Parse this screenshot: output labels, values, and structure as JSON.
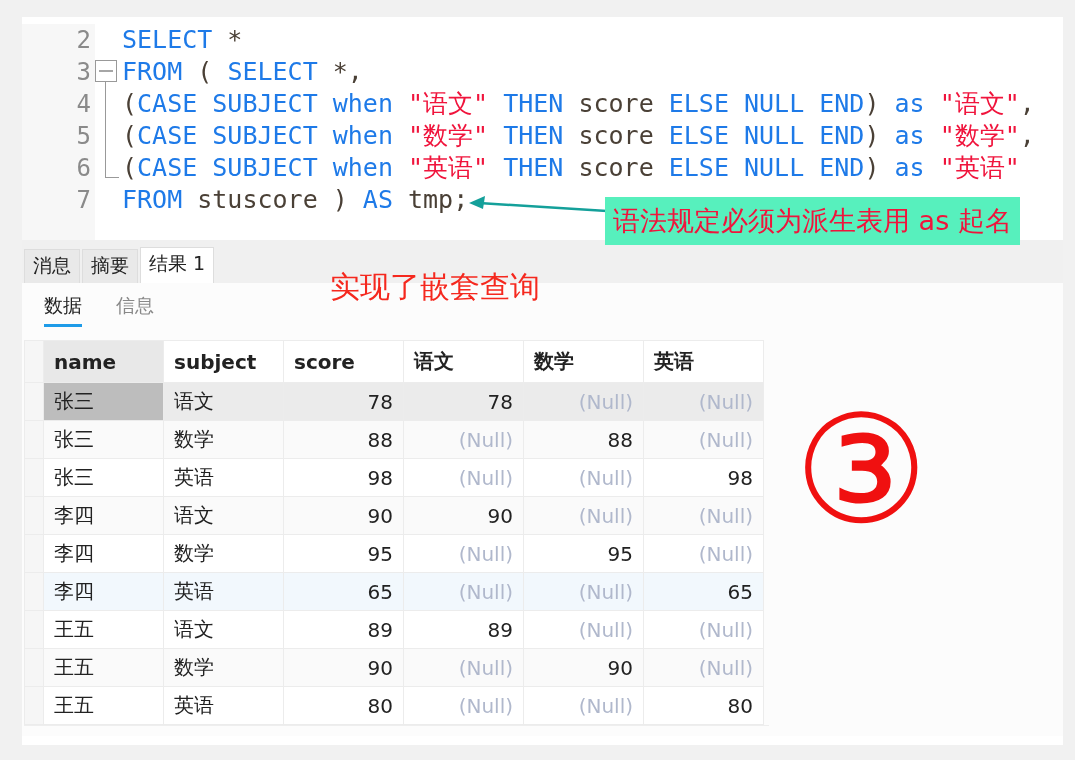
{
  "editor": {
    "lines": [
      {
        "number": "2",
        "kind": "plain",
        "tokens": [
          {
            "t": "SELECT",
            "kind": "keyword"
          },
          {
            "t": " *",
            "kind": "plain"
          }
        ]
      },
      {
        "number": "3",
        "kind": "foldstart",
        "tokens": [
          {
            "t": "FROM",
            "kind": "keyword"
          },
          {
            "t": " ( ",
            "kind": "plain"
          },
          {
            "t": "SELECT",
            "kind": "keyword"
          },
          {
            "t": " *,",
            "kind": "plain"
          }
        ]
      },
      {
        "number": "4",
        "kind": "foldinner",
        "tokens": [
          {
            "t": "(",
            "kind": "plain"
          },
          {
            "t": "CASE SUBJECT when ",
            "kind": "keyword"
          },
          {
            "t": "\"语文\"",
            "kind": "string"
          },
          {
            "t": " THEN ",
            "kind": "keyword"
          },
          {
            "t": "score",
            "kind": "plain"
          },
          {
            "t": " ELSE NULL END",
            "kind": "keyword"
          },
          {
            "t": ")",
            "kind": "plain"
          },
          {
            "t": " as ",
            "kind": "keyword"
          },
          {
            "t": "\"语文\"",
            "kind": "string"
          },
          {
            "t": ",",
            "kind": "plain"
          }
        ]
      },
      {
        "number": "5",
        "kind": "foldinner",
        "tokens": [
          {
            "t": "(",
            "kind": "plain"
          },
          {
            "t": "CASE SUBJECT when ",
            "kind": "keyword"
          },
          {
            "t": "\"数学\"",
            "kind": "string"
          },
          {
            "t": " THEN ",
            "kind": "keyword"
          },
          {
            "t": "score",
            "kind": "plain"
          },
          {
            "t": " ELSE NULL END",
            "kind": "keyword"
          },
          {
            "t": ")",
            "kind": "plain"
          },
          {
            "t": " as ",
            "kind": "keyword"
          },
          {
            "t": "\"数学\"",
            "kind": "string"
          },
          {
            "t": ",",
            "kind": "plain"
          }
        ]
      },
      {
        "number": "6",
        "kind": "foldend",
        "tokens": [
          {
            "t": "(",
            "kind": "plain"
          },
          {
            "t": "CASE SUBJECT when ",
            "kind": "keyword"
          },
          {
            "t": "\"英语\"",
            "kind": "string"
          },
          {
            "t": " THEN ",
            "kind": "keyword"
          },
          {
            "t": "score",
            "kind": "plain"
          },
          {
            "t": " ELSE NULL END",
            "kind": "keyword"
          },
          {
            "t": ")",
            "kind": "plain"
          },
          {
            "t": " as ",
            "kind": "keyword"
          },
          {
            "t": "\"英语\"",
            "kind": "string"
          }
        ]
      },
      {
        "number": "7",
        "kind": "plain",
        "tokens": [
          {
            "t": "FROM",
            "kind": "keyword"
          },
          {
            "t": " stuscore ) ",
            "kind": "plain"
          },
          {
            "t": "AS",
            "kind": "keyword"
          },
          {
            "t": " tmp;",
            "kind": "plain"
          }
        ]
      }
    ]
  },
  "callout": {
    "text": "语法规定必须为派生表用 as 起名"
  },
  "result_tabs": [
    {
      "label": "消息",
      "selected": false
    },
    {
      "label": "摘要",
      "selected": false
    },
    {
      "label": "结果 1",
      "selected": true
    }
  ],
  "annotation_note": "实现了嵌套查询",
  "sub_tabs": [
    {
      "label": "数据",
      "selected": true
    },
    {
      "label": "信息",
      "selected": false
    }
  ],
  "annotation_mark": "③",
  "table": {
    "columns": [
      {
        "label": "name",
        "numeric": false
      },
      {
        "label": "subject",
        "numeric": false
      },
      {
        "label": "score",
        "numeric": true
      },
      {
        "label": "语文",
        "numeric": true
      },
      {
        "label": "数学",
        "numeric": true
      },
      {
        "label": "英语",
        "numeric": true
      }
    ],
    "rows": [
      {
        "selected": true,
        "highlighted": false,
        "cells": [
          {
            "text": "张三",
            "null": false
          },
          {
            "text": "语文",
            "null": false
          },
          {
            "text": "78",
            "null": false
          },
          {
            "text": "78",
            "null": false
          },
          {
            "text": "(Null)",
            "null": true
          },
          {
            "text": "(Null)",
            "null": true
          }
        ]
      },
      {
        "selected": false,
        "highlighted": false,
        "cells": [
          {
            "text": "张三",
            "null": false
          },
          {
            "text": "数学",
            "null": false
          },
          {
            "text": "88",
            "null": false
          },
          {
            "text": "(Null)",
            "null": true
          },
          {
            "text": "88",
            "null": false
          },
          {
            "text": "(Null)",
            "null": true
          }
        ]
      },
      {
        "selected": false,
        "highlighted": false,
        "cells": [
          {
            "text": "张三",
            "null": false
          },
          {
            "text": "英语",
            "null": false
          },
          {
            "text": "98",
            "null": false
          },
          {
            "text": "(Null)",
            "null": true
          },
          {
            "text": "(Null)",
            "null": true
          },
          {
            "text": "98",
            "null": false
          }
        ]
      },
      {
        "selected": false,
        "highlighted": false,
        "cells": [
          {
            "text": "李四",
            "null": false
          },
          {
            "text": "语文",
            "null": false
          },
          {
            "text": "90",
            "null": false
          },
          {
            "text": "90",
            "null": false
          },
          {
            "text": "(Null)",
            "null": true
          },
          {
            "text": "(Null)",
            "null": true
          }
        ]
      },
      {
        "selected": false,
        "highlighted": false,
        "cells": [
          {
            "text": "李四",
            "null": false
          },
          {
            "text": "数学",
            "null": false
          },
          {
            "text": "95",
            "null": false
          },
          {
            "text": "(Null)",
            "null": true
          },
          {
            "text": "95",
            "null": false
          },
          {
            "text": "(Null)",
            "null": true
          }
        ]
      },
      {
        "selected": false,
        "highlighted": true,
        "cells": [
          {
            "text": "李四",
            "null": false
          },
          {
            "text": "英语",
            "null": false
          },
          {
            "text": "65",
            "null": false
          },
          {
            "text": "(Null)",
            "null": true
          },
          {
            "text": "(Null)",
            "null": true
          },
          {
            "text": "65",
            "null": false
          }
        ]
      },
      {
        "selected": false,
        "highlighted": false,
        "cells": [
          {
            "text": "王五",
            "null": false
          },
          {
            "text": "语文",
            "null": false
          },
          {
            "text": "89",
            "null": false
          },
          {
            "text": "89",
            "null": false
          },
          {
            "text": "(Null)",
            "null": true
          },
          {
            "text": "(Null)",
            "null": true
          }
        ]
      },
      {
        "selected": false,
        "highlighted": false,
        "cells": [
          {
            "text": "王五",
            "null": false
          },
          {
            "text": "数学",
            "null": false
          },
          {
            "text": "90",
            "null": false
          },
          {
            "text": "(Null)",
            "null": true
          },
          {
            "text": "90",
            "null": false
          },
          {
            "text": "(Null)",
            "null": true
          }
        ]
      },
      {
        "selected": false,
        "highlighted": false,
        "cells": [
          {
            "text": "王五",
            "null": false
          },
          {
            "text": "英语",
            "null": false
          },
          {
            "text": "80",
            "null": false
          },
          {
            "text": "(Null)",
            "null": true
          },
          {
            "text": "(Null)",
            "null": true
          },
          {
            "text": "80",
            "null": false
          }
        ]
      }
    ]
  }
}
